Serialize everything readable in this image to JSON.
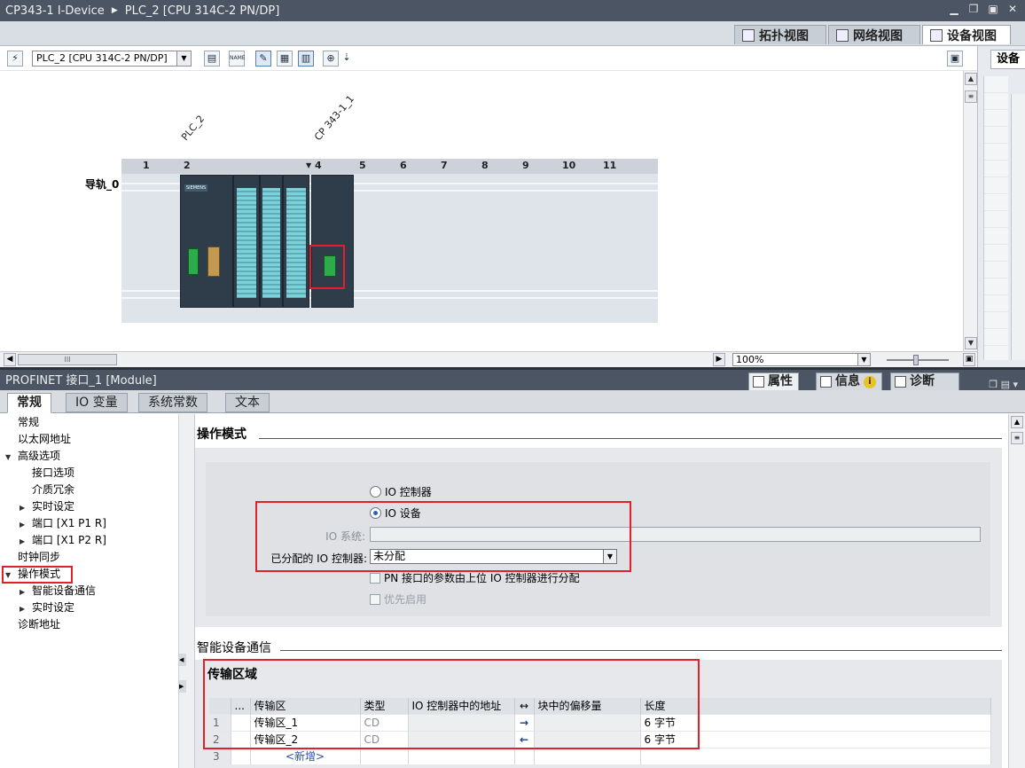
{
  "titlebar": {
    "project": "CP343-1 I-Device",
    "device": "PLC_2 [CPU 314C-2 PN/DP]"
  },
  "view_tabs": [
    {
      "label": "拓扑视图",
      "icon": "topology-icon"
    },
    {
      "label": "网络视图",
      "icon": "network-icon"
    },
    {
      "label": "设备视图",
      "icon": "device-icon"
    }
  ],
  "toolbar": {
    "device_select": "PLC_2 [CPU 314C-2 PN/DP]",
    "name_icon": "NAME"
  },
  "right_strip": {
    "tab": "设备"
  },
  "canvas": {
    "rack_label_1": "PLC_2",
    "rack_label_2": "CP 343-1_1",
    "rail_label": "导轨_0",
    "slots": [
      "1",
      "2",
      "4",
      "5",
      "6",
      "7",
      "8",
      "9",
      "10",
      "11"
    ],
    "cpu_brand": "SIEMENS"
  },
  "hbar": {
    "zoom": "100%",
    "thumb": "III"
  },
  "properties": {
    "title": "PROFINET 接口_1 [Module]",
    "tabs": [
      {
        "label": "属性",
        "icon": "properties-icon"
      },
      {
        "label": "信息",
        "icon": "info-icon"
      },
      {
        "label": "诊断",
        "icon": "diagnostics-icon"
      }
    ],
    "info_badge": "i"
  },
  "subtabs": [
    "常规",
    "IO 变量",
    "系统常数",
    "文本"
  ],
  "nav": {
    "items": [
      {
        "label": "常规"
      },
      {
        "label": "以太网地址"
      },
      {
        "label": "高级选项"
      },
      {
        "label": "接口选项"
      },
      {
        "label": "介质冗余"
      },
      {
        "label": "实时设定"
      },
      {
        "label": "端口 [X1 P1 R]"
      },
      {
        "label": "端口 [X1 P2 R]"
      },
      {
        "label": "时钟同步"
      },
      {
        "label": "操作模式"
      },
      {
        "label": "智能设备通信"
      },
      {
        "label": "实时设定"
      },
      {
        "label": "诊断地址"
      }
    ]
  },
  "operation_mode": {
    "title": "操作模式",
    "radio_controller": "IO 控制器",
    "radio_device": "IO 设备",
    "io_system_label": "IO 系统:",
    "assigned_label": "已分配的 IO 控制器:",
    "assigned_value": "未分配",
    "check_pn_params": "PN 接口的参数由上位 IO 控制器进行分配",
    "check_priority": "优先启用"
  },
  "idevice": {
    "title": "智能设备通信",
    "area_title": "传输区域",
    "columns": [
      "...",
      "传输区",
      "类型",
      "IO 控制器中的地址",
      "↔",
      "块中的偏移量",
      "长度"
    ],
    "rows": [
      {
        "num": "1",
        "name": "传输区_1",
        "type": "CD",
        "addr": "",
        "dir": "→",
        "offset": "",
        "len": "6 字节"
      },
      {
        "num": "2",
        "name": "传输区_2",
        "type": "CD",
        "addr": "",
        "dir": "←",
        "offset": "",
        "len": "6 字节"
      },
      {
        "num": "3",
        "name": "<新增>",
        "type": "",
        "addr": "",
        "dir": "",
        "offset": "",
        "len": ""
      }
    ]
  }
}
